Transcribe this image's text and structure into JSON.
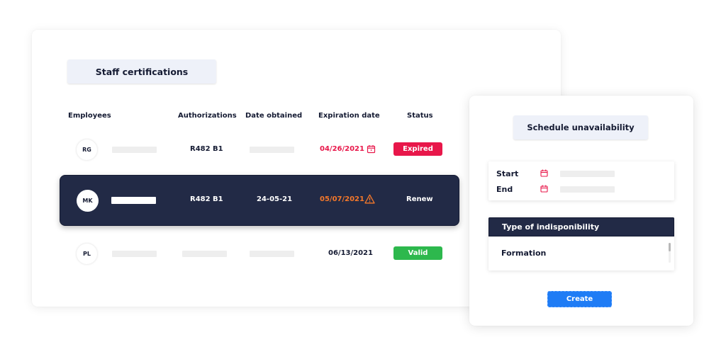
{
  "certifications": {
    "title": "Staff certifications",
    "columns": {
      "employees": "Employees",
      "authorizations": "Authorizations",
      "date_obtained": "Date obtained",
      "expiration_date": "Expiration date",
      "status": "Status"
    },
    "rows": [
      {
        "initials": "RG",
        "authorization": "R482 B1",
        "expiration_date": "04/26/2021",
        "expiration_icon": "calendar-icon",
        "status": "Expired",
        "status_color": "#e8174a",
        "date_color": "#e8174a"
      },
      {
        "initials": "MK",
        "authorization": "R482 B1",
        "date_obtained": "24-05-21",
        "expiration_date": "05/07/2021",
        "expiration_icon": "warning-icon",
        "status": "Renew",
        "date_color": "#f5782a",
        "selected": true
      },
      {
        "initials": "PL",
        "expiration_date": "06/13/2021",
        "status": "Valid",
        "status_color": "#2db84d"
      }
    ]
  },
  "schedule": {
    "title": "Schedule unavailability",
    "start_label": "Start",
    "end_label": "End",
    "type_header": "Type of indisponibility",
    "type_option": "Formation",
    "create_label": "Create",
    "accent_color": "#1f7cf5"
  },
  "colors": {
    "navy": "#222a46",
    "red": "#e8174a",
    "orange": "#f5782a",
    "green": "#2db84d"
  }
}
